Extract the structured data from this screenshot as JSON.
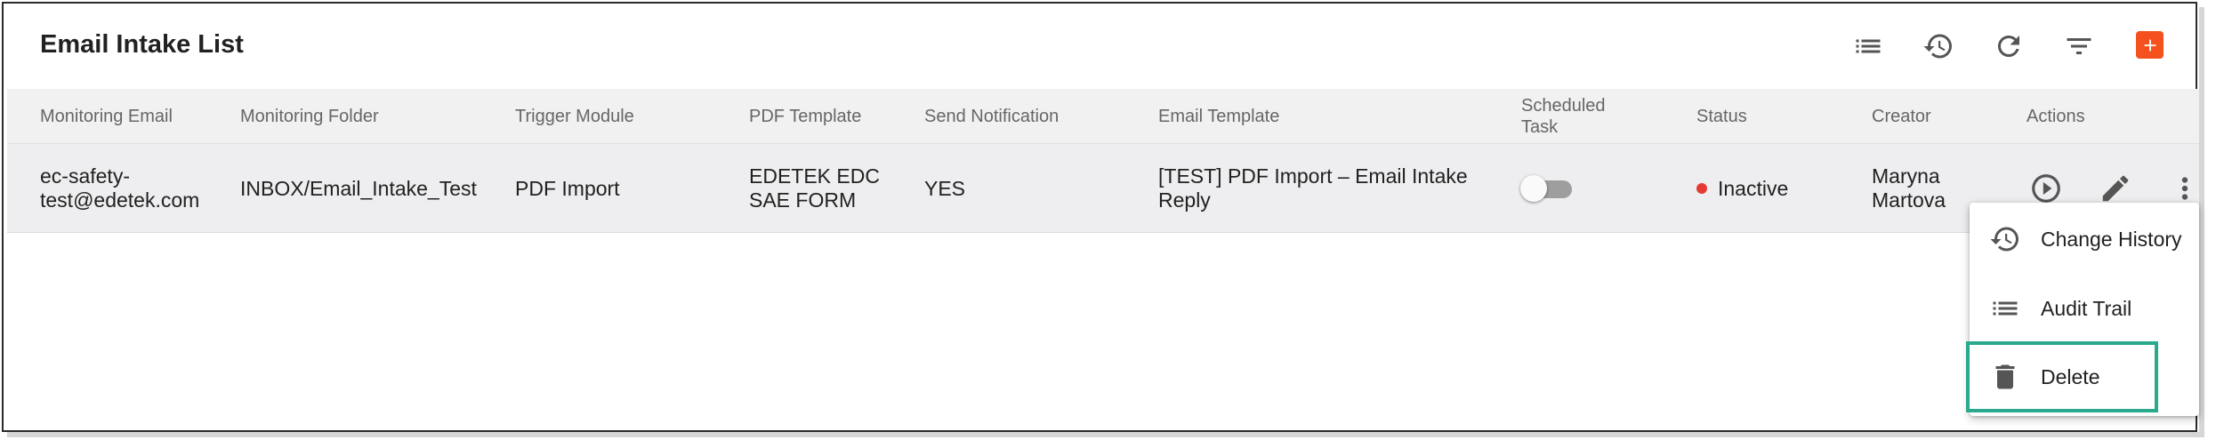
{
  "page": {
    "title": "Email Intake List"
  },
  "toolbar": {
    "buttons": [
      "list-icon",
      "history-icon",
      "refresh-icon",
      "filter-icon",
      "add-icon"
    ],
    "accent_color": "#f4511e"
  },
  "table": {
    "columns": [
      "Monitoring Email",
      "Monitoring Folder",
      "Trigger Module",
      "PDF Template",
      "Send Notification",
      "Email Template",
      "Scheduled Task",
      "Status",
      "Creator",
      "Actions"
    ],
    "rows": [
      {
        "monitoring_email": "ec-safety-test@edetek.com",
        "monitoring_email_line1": "ec-safety-",
        "monitoring_email_line2": "test@edetek.com",
        "monitoring_folder": "INBOX/Email_Intake_Test",
        "trigger_module": "PDF Import",
        "pdf_template_line1": "EDETEK EDC",
        "pdf_template_line2": "SAE FORM",
        "send_notification": "YES",
        "email_template_line1": "[TEST] PDF Import – Email Intake",
        "email_template_line2": "Reply",
        "scheduled_task": false,
        "status": "Inactive",
        "status_color": "#e53935",
        "creator_line1": "Maryna",
        "creator_line2": "Martova",
        "actions": [
          "play-icon",
          "edit-icon",
          "more-vert-icon"
        ]
      }
    ]
  },
  "context_menu": {
    "items": [
      {
        "label": "Change History",
        "icon": "history-icon"
      },
      {
        "label": "Audit Trail",
        "icon": "list-icon"
      },
      {
        "label": "Delete",
        "icon": "trash-icon",
        "highlighted": true
      }
    ],
    "highlight_color": "#2aa98c"
  }
}
